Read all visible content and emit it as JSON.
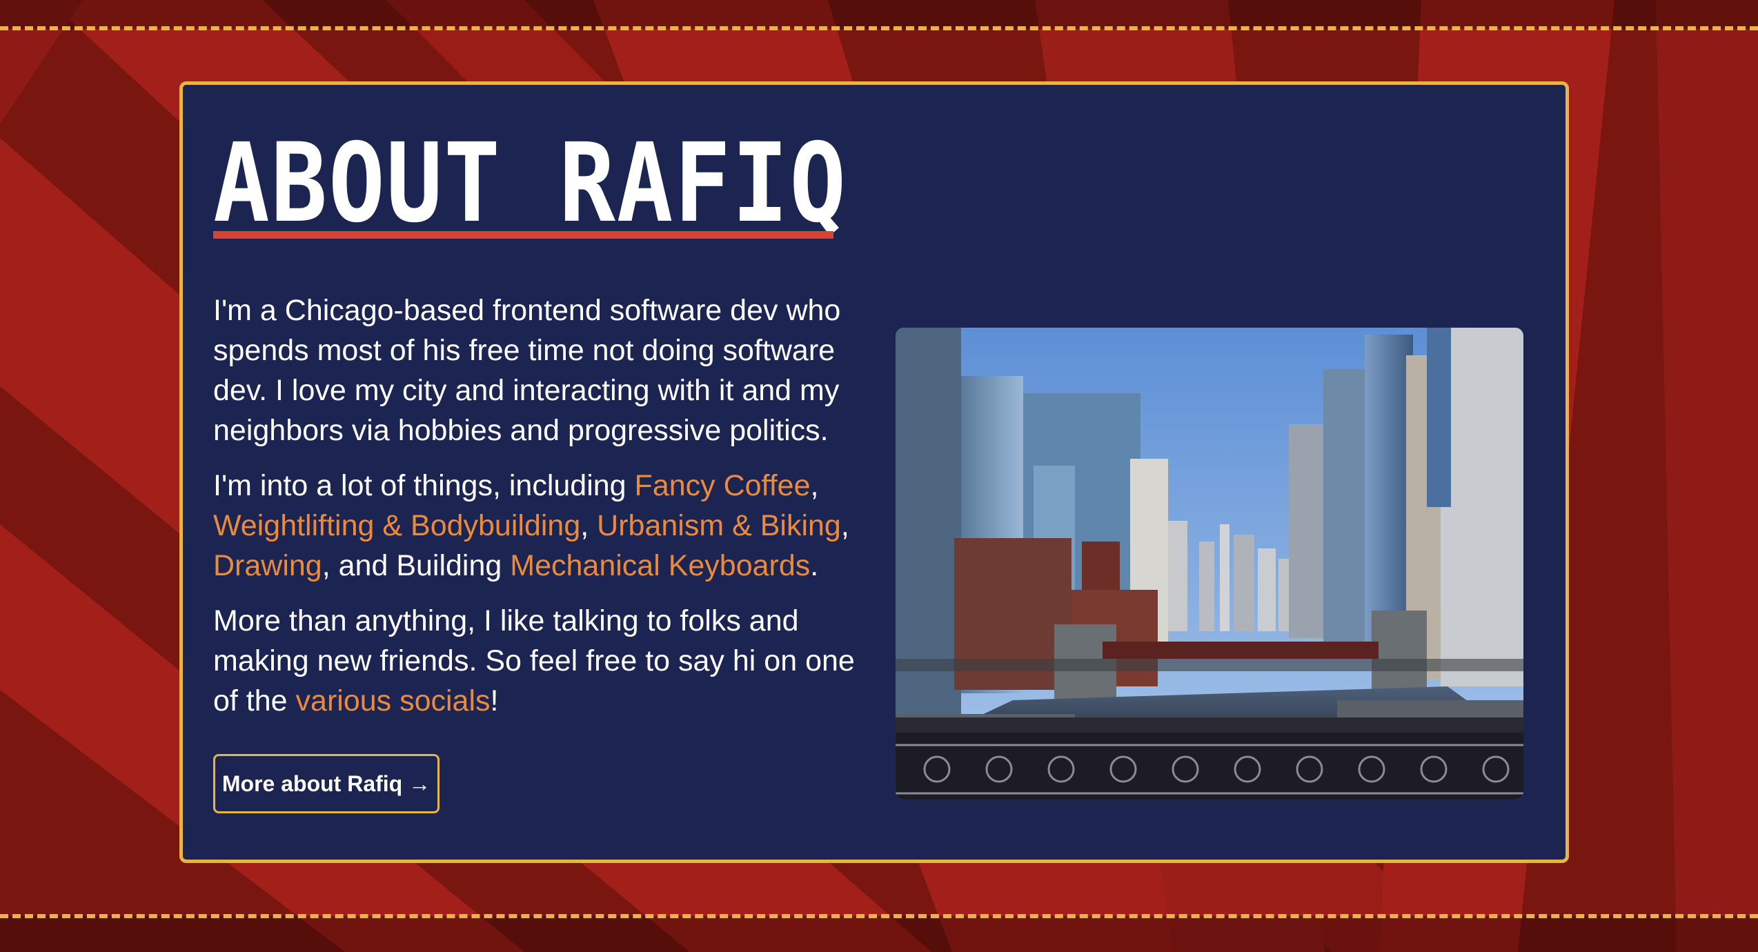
{
  "about": {
    "title": "ABOUT RAFIQ",
    "para1": "I'm a Chicago-based frontend software dev who spends most of his free time not doing software dev. I love my city and interacting with it and my neighbors via hobbies and progressive politics.",
    "para2": {
      "intro": "I'm into a lot of things, including ",
      "links": [
        "Fancy Coffee",
        "Weightlifting & Bodybuilding",
        "Urbanism & Biking",
        "Drawing",
        "Mechanical Keyboards"
      ],
      "sep1": ",",
      "sep2": ",",
      "sep3": ",",
      "connector": ", and Building ",
      "end": "."
    },
    "para3": {
      "text": "More than anything, I like talking to folks and making new friends. So feel free to say hi on one of the ",
      "link": "various socials",
      "end": "!"
    },
    "button_label": "More about Rafiq →"
  },
  "colors": {
    "background_red": "#a3201a",
    "card_navy": "#1c2452",
    "border_gold": "#e8b448",
    "accent_red": "#d94336",
    "link_orange": "#ec8a3b"
  }
}
